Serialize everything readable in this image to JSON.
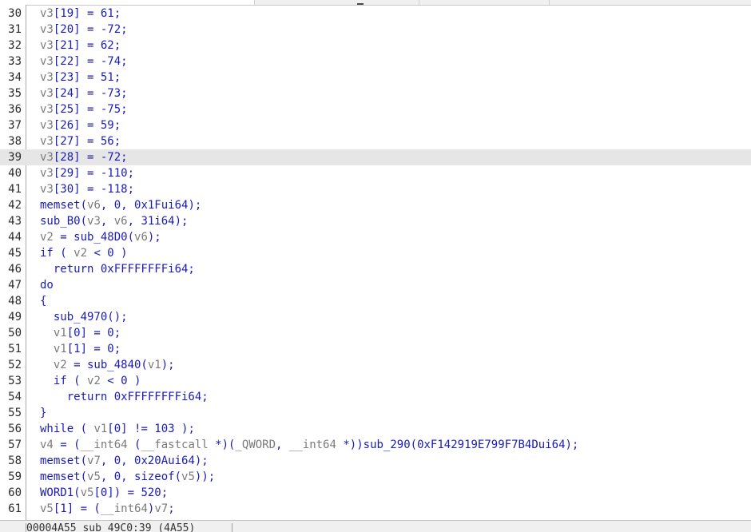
{
  "editor": {
    "highlighted_line": "39",
    "lines": [
      {
        "num": "30",
        "indent": "",
        "segments": [
          [
            "v",
            "v3"
          ],
          [
            "s",
            "[19] = 61;"
          ]
        ]
      },
      {
        "num": "31",
        "indent": "",
        "segments": [
          [
            "v",
            "v3"
          ],
          [
            "s",
            "[20] = -72;"
          ]
        ]
      },
      {
        "num": "32",
        "indent": "",
        "segments": [
          [
            "v",
            "v3"
          ],
          [
            "s",
            "[21] = 62;"
          ]
        ]
      },
      {
        "num": "33",
        "indent": "",
        "segments": [
          [
            "v",
            "v3"
          ],
          [
            "s",
            "[22] = -74;"
          ]
        ]
      },
      {
        "num": "34",
        "indent": "",
        "segments": [
          [
            "v",
            "v3"
          ],
          [
            "s",
            "[23] = 51;"
          ]
        ]
      },
      {
        "num": "35",
        "indent": "",
        "segments": [
          [
            "v",
            "v3"
          ],
          [
            "s",
            "[24] = -73;"
          ]
        ]
      },
      {
        "num": "36",
        "indent": "",
        "segments": [
          [
            "v",
            "v3"
          ],
          [
            "s",
            "[25] = -75;"
          ]
        ]
      },
      {
        "num": "37",
        "indent": "",
        "segments": [
          [
            "v",
            "v3"
          ],
          [
            "s",
            "[26] = 59;"
          ]
        ]
      },
      {
        "num": "38",
        "indent": "",
        "segments": [
          [
            "v",
            "v3"
          ],
          [
            "s",
            "[27] = 56;"
          ]
        ]
      },
      {
        "num": "39",
        "indent": "",
        "segments": [
          [
            "v",
            "v3"
          ],
          [
            "s",
            "[28] = -72;"
          ]
        ]
      },
      {
        "num": "40",
        "indent": "",
        "segments": [
          [
            "v",
            "v3"
          ],
          [
            "s",
            "[29] = -110;"
          ]
        ]
      },
      {
        "num": "41",
        "indent": "",
        "segments": [
          [
            "v",
            "v3"
          ],
          [
            "s",
            "[30] = -118;"
          ]
        ]
      },
      {
        "num": "42",
        "indent": "",
        "segments": [
          [
            "s",
            "memset("
          ],
          [
            "v",
            "v6"
          ],
          [
            "s",
            ", 0, 0x1Fui64);"
          ]
        ]
      },
      {
        "num": "43",
        "indent": "",
        "segments": [
          [
            "s",
            "sub_B0("
          ],
          [
            "v",
            "v3"
          ],
          [
            "s",
            ", "
          ],
          [
            "v",
            "v6"
          ],
          [
            "s",
            ", 31i64);"
          ]
        ]
      },
      {
        "num": "44",
        "indent": "",
        "segments": [
          [
            "v",
            "v2"
          ],
          [
            "s",
            " = sub_48D0("
          ],
          [
            "v",
            "v6"
          ],
          [
            "s",
            ");"
          ]
        ]
      },
      {
        "num": "45",
        "indent": "",
        "segments": [
          [
            "s",
            "if ( "
          ],
          [
            "v",
            "v2"
          ],
          [
            "s",
            " < 0 )"
          ]
        ]
      },
      {
        "num": "46",
        "indent": "  ",
        "segments": [
          [
            "s",
            "return 0xFFFFFFFFi64;"
          ]
        ]
      },
      {
        "num": "47",
        "indent": "",
        "segments": [
          [
            "s",
            "do"
          ]
        ]
      },
      {
        "num": "48",
        "indent": "",
        "segments": [
          [
            "s",
            "{"
          ]
        ]
      },
      {
        "num": "49",
        "indent": "  ",
        "segments": [
          [
            "s",
            "sub_4970();"
          ]
        ]
      },
      {
        "num": "50",
        "indent": "  ",
        "segments": [
          [
            "v",
            "v1"
          ],
          [
            "s",
            "[0] = 0;"
          ]
        ]
      },
      {
        "num": "51",
        "indent": "  ",
        "segments": [
          [
            "v",
            "v1"
          ],
          [
            "s",
            "[1] = 0;"
          ]
        ]
      },
      {
        "num": "52",
        "indent": "  ",
        "segments": [
          [
            "v",
            "v2"
          ],
          [
            "s",
            " = sub_4840("
          ],
          [
            "v",
            "v1"
          ],
          [
            "s",
            ");"
          ]
        ]
      },
      {
        "num": "53",
        "indent": "  ",
        "segments": [
          [
            "s",
            "if ( "
          ],
          [
            "v",
            "v2"
          ],
          [
            "s",
            " < 0 )"
          ]
        ]
      },
      {
        "num": "54",
        "indent": "    ",
        "segments": [
          [
            "s",
            "return 0xFFFFFFFFi64;"
          ]
        ]
      },
      {
        "num": "55",
        "indent": "",
        "segments": [
          [
            "s",
            "}"
          ]
        ]
      },
      {
        "num": "56",
        "indent": "",
        "segments": [
          [
            "s",
            "while ( "
          ],
          [
            "v",
            "v1"
          ],
          [
            "s",
            "[0] != 103 );"
          ]
        ]
      },
      {
        "num": "57",
        "indent": "",
        "segments": [
          [
            "v",
            "v4"
          ],
          [
            "s",
            " = ("
          ],
          [
            "v",
            "__int64"
          ],
          [
            "s",
            " ("
          ],
          [
            "v",
            "__fastcall"
          ],
          [
            "s",
            " *)("
          ],
          [
            "v",
            "_QWORD"
          ],
          [
            "s",
            ", "
          ],
          [
            "v",
            "__int64"
          ],
          [
            "s",
            " *))sub_290(0xF142919E799F7B4Dui64);"
          ]
        ]
      },
      {
        "num": "58",
        "indent": "",
        "segments": [
          [
            "s",
            "memset("
          ],
          [
            "v",
            "v7"
          ],
          [
            "s",
            ", 0, 0x20Aui64);"
          ]
        ]
      },
      {
        "num": "59",
        "indent": "",
        "segments": [
          [
            "s",
            "memset("
          ],
          [
            "v",
            "v5"
          ],
          [
            "s",
            ", 0, sizeof("
          ],
          [
            "v",
            "v5"
          ],
          [
            "s",
            "));"
          ]
        ]
      },
      {
        "num": "60",
        "indent": "",
        "segments": [
          [
            "s",
            "WORD1("
          ],
          [
            "v",
            "v5"
          ],
          [
            "s",
            "[0]) = 520;"
          ]
        ]
      },
      {
        "num": "61",
        "indent": "",
        "segments": [
          [
            "v",
            "v5"
          ],
          [
            "s",
            "[1] = ("
          ],
          [
            "v",
            "__int64"
          ],
          [
            "s",
            ")"
          ],
          [
            "v",
            "v7"
          ],
          [
            "s",
            ";"
          ]
        ]
      }
    ]
  },
  "statusbar": {
    "text": "00004A55 sub_49C0:39 (4A55)"
  },
  "colors": {
    "code": "#1a1ab8",
    "variable": "#7a7a7a",
    "line_number": "#2b2b2b",
    "highlight": "#e6e6e6"
  }
}
